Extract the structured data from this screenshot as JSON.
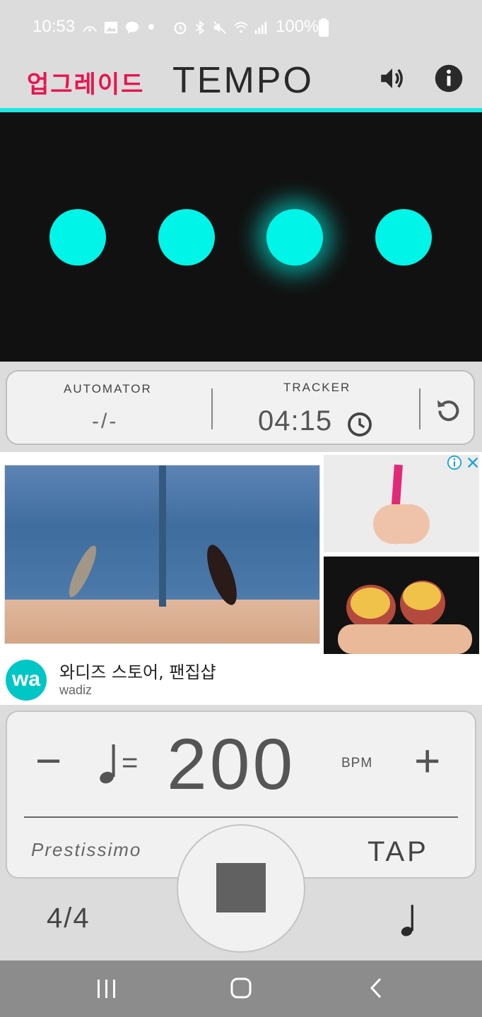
{
  "status_bar": {
    "time": "10:53",
    "battery": "100%"
  },
  "header": {
    "upgrade_label": "업그레이드",
    "title": "TEMPO",
    "sound_icon": "volume-icon",
    "info_icon": "info-icon"
  },
  "beats": {
    "count": 4,
    "active_index": 2,
    "color": "#00f5e8"
  },
  "info": {
    "automator_label": "AUTOMATOR",
    "automator_value": "-/-",
    "tracker_label": "TRACKER",
    "tracker_value": "04:15",
    "clock_icon": "clock-icon",
    "reset_icon": "reset-icon"
  },
  "ad": {
    "title": "와디즈 스토어, 팬집샵",
    "advertiser": "wadiz",
    "logo_text": "wa"
  },
  "bpm": {
    "minus_label": "−",
    "equals_label": "=",
    "value": "200",
    "unit": "BPM",
    "plus_label": "+",
    "tempo_name": "Prestissimo",
    "tap_label": "TAP"
  },
  "bottom": {
    "time_signature": "4/4",
    "note_icon": "quarter-note-icon",
    "stop_icon": "stop-icon"
  },
  "colors": {
    "accent": "#1de9e2",
    "upgrade": "#e8144f",
    "beat": "#00f5e8"
  }
}
